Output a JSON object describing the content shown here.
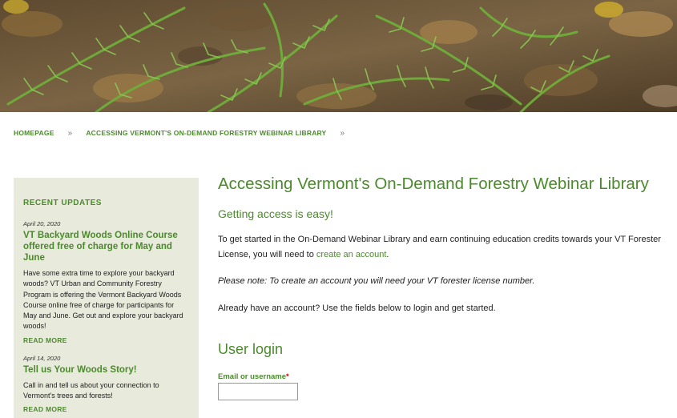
{
  "hero": {
    "image": "fern-forest-floor-photo"
  },
  "breadcrumb": {
    "items": [
      "HOMEPAGE",
      "ACCESSING VERMONT'S ON-DEMAND FORESTRY WEBINAR LIBRARY"
    ],
    "separator": "»"
  },
  "sidebar": {
    "heading": "RECENT UPDATES",
    "updates": [
      {
        "date": "April 20, 2020",
        "title": "VT Backyard Woods Online Course offered free of charge for May and June",
        "body": "Have some extra time to explore your backyard woods? VT Urban and Community Forestry Program is offering the Vermont Backyard Woods Course online free of charge for participants for May and June. Get out and explore your backyard woods!",
        "more": "READ MORE"
      },
      {
        "date": "April 14, 2020",
        "title": "Tell us Your Woods Story!",
        "body": "Call in and tell us about your connection to Vermont's trees and forests!",
        "more": "READ MORE"
      }
    ]
  },
  "main": {
    "title": "Accessing Vermont's On-Demand Forestry Webinar Library",
    "subtitle": "Getting access is easy!",
    "p1_before": "To get started in the On-Demand Webinar Library and earn continuing education credits towards your VT Forester License, you will need to ",
    "p1_link": "create an account",
    "p1_after": ".",
    "p2": "Please note: To create an account you will need your VT forester license number.",
    "p3": "Already have an account? Use the fields below to login and get started.",
    "login_heading": "User login",
    "email_label": "Email or username",
    "required_mark": "*"
  },
  "colors": {
    "accent": "#4b8a2c",
    "sidebar_bg": "#e8eadc",
    "required": "#cc0000"
  }
}
